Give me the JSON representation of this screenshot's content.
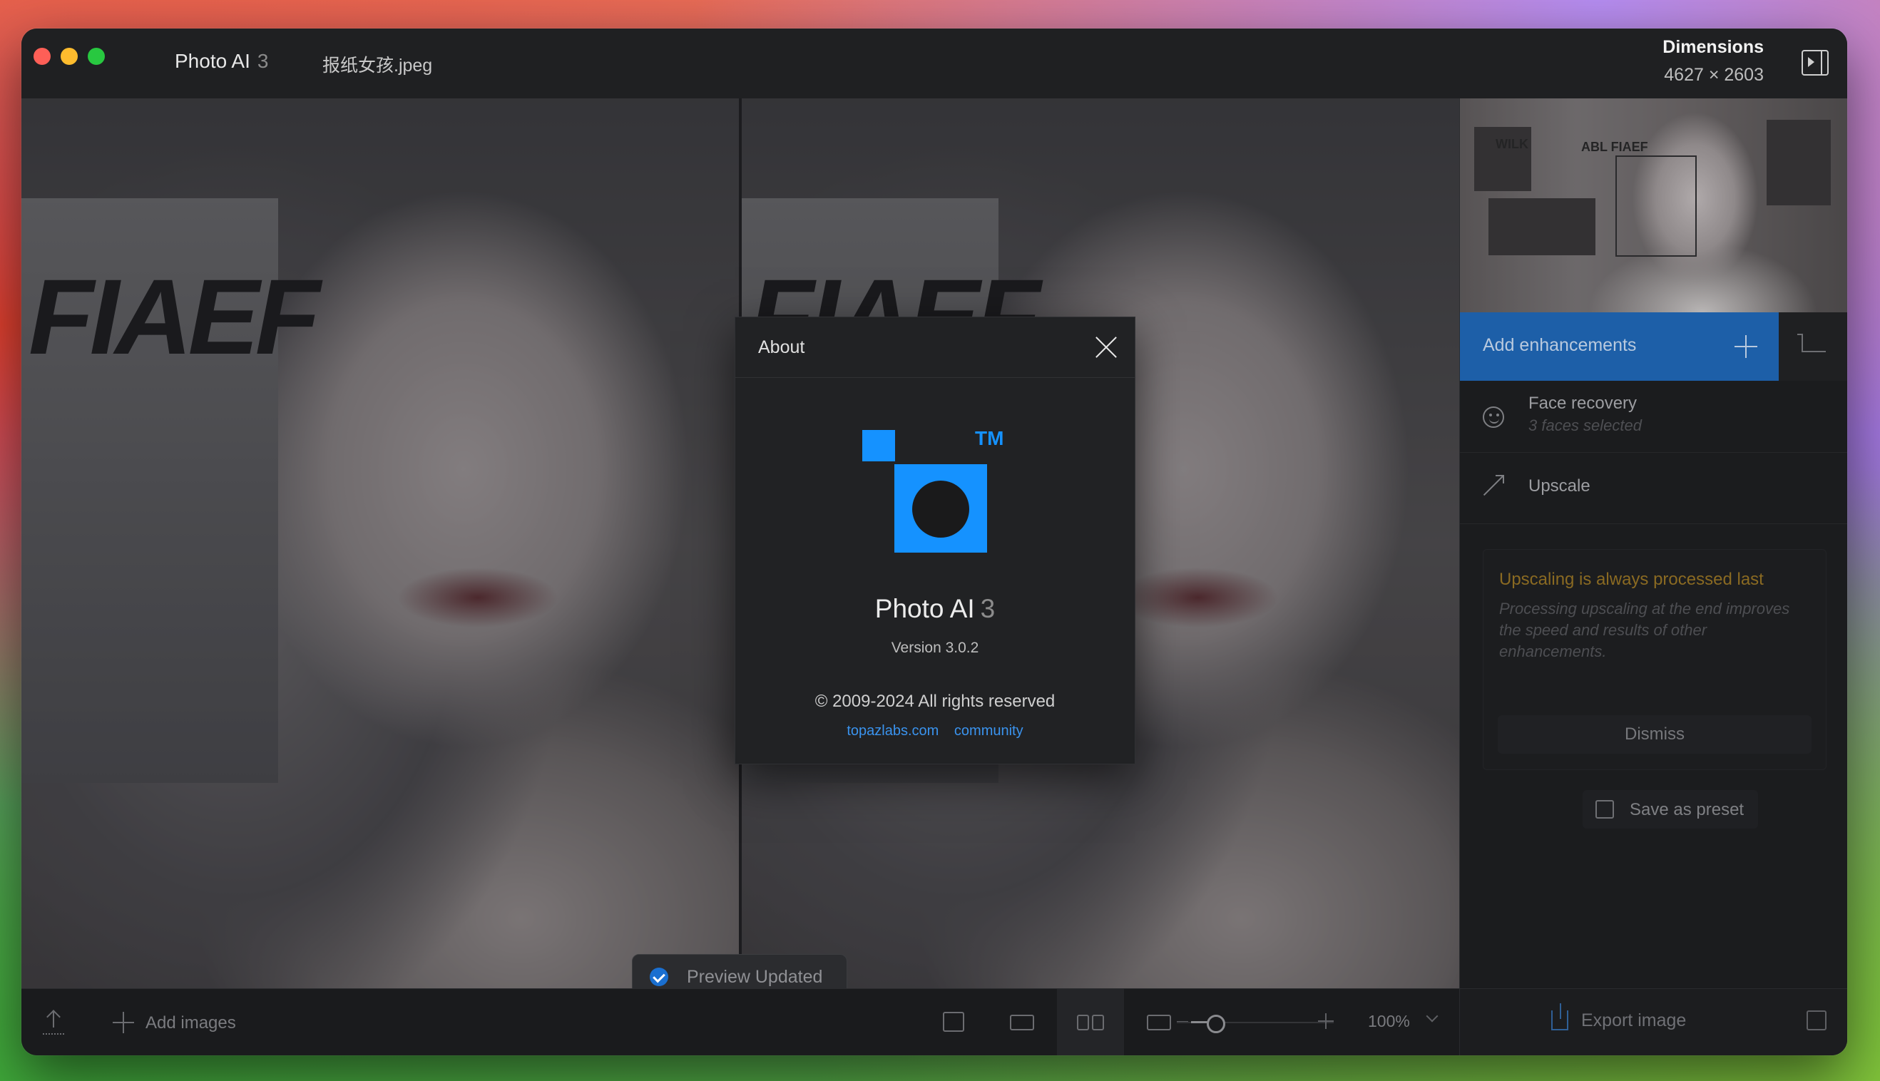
{
  "titlebar": {
    "app_name": "Photo AI",
    "app_version_major": "3",
    "file_name": "报纸女孩.jpeg",
    "dimensions_label": "Dimensions",
    "dimensions_value": "4627 × 2603"
  },
  "about_dialog": {
    "title": "About",
    "logo_tm": "TM",
    "product_name": "Photo AI",
    "product_major": "3",
    "version": "Version 3.0.2",
    "copyright": "© 2009-2024 All rights reserved",
    "link_site": "topazlabs.com",
    "link_community": "community"
  },
  "toast": {
    "text": "Preview Updated"
  },
  "sidebar": {
    "add_enhancements": "Add enhancements",
    "enhancements": [
      {
        "label": "Face recovery",
        "sub": "3 faces selected",
        "icon": "face-icon"
      },
      {
        "label": "Upscale",
        "sub": "",
        "icon": "upscale-icon"
      }
    ],
    "note": {
      "title": "Upscaling is always processed last",
      "body": "Processing upscaling at the end improves the speed and results of other enhancements.",
      "dismiss": "Dismiss"
    },
    "save_preset": "Save as preset"
  },
  "bottombar": {
    "add_images": "Add images",
    "zoom": "100%",
    "export": "Export image"
  },
  "colors": {
    "accent": "#1592ff",
    "selected_panel": "#1d5fa8",
    "warning": "#8a6a22"
  },
  "thumbnail_text": [
    "WILK",
    "ABL FIAEF"
  ],
  "image_text": [
    "FIAEF"
  ]
}
